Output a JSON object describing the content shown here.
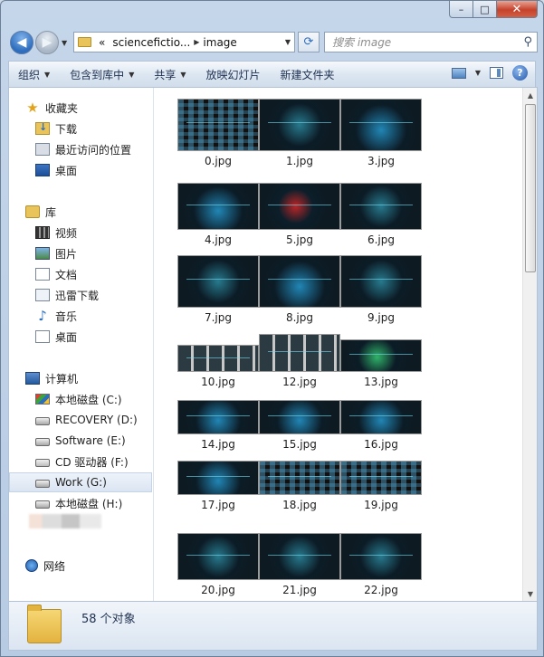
{
  "window": {
    "caption_buttons": {
      "minimize": "–",
      "maximize": "□",
      "close": "✕"
    }
  },
  "address": {
    "overflow": "«",
    "crumbs": [
      "sciencefictio...",
      "image"
    ],
    "search_placeholder": "搜索 image"
  },
  "toolbar": {
    "organize": "组织",
    "include_in_library": "包含到库中",
    "share": "共享",
    "slideshow": "放映幻灯片",
    "new_folder": "新建文件夹",
    "help": "?"
  },
  "nav": {
    "favorites": "收藏夹",
    "downloads": "下载",
    "recent": "最近访问的位置",
    "desktop": "桌面",
    "libraries": "库",
    "videos": "视频",
    "pictures": "图片",
    "documents": "文档",
    "thunder": "迅雷下载",
    "music": "音乐",
    "desktop2": "桌面",
    "computer": "计算机",
    "drive_c": "本地磁盘 (C:)",
    "drive_d": "RECOVERY (D:)",
    "drive_e": "Software (E:)",
    "drive_f": "CD 驱动器 (F:)",
    "drive_g": "Work (G:)",
    "drive_h": "本地磁盘 (H:)",
    "network": "网络"
  },
  "files": [
    {
      "name": "0.jpg",
      "style": "grid-ui"
    },
    {
      "name": "1.jpg",
      "style": ""
    },
    {
      "name": "3.jpg",
      "style": "blue"
    },
    {
      "name": "4.jpg",
      "style": "blue"
    },
    {
      "name": "5.jpg",
      "style": "red"
    },
    {
      "name": "6.jpg",
      "style": ""
    },
    {
      "name": "7.jpg",
      "style": ""
    },
    {
      "name": "8.jpg",
      "style": "blue"
    },
    {
      "name": "9.jpg",
      "style": ""
    },
    {
      "name": "10.jpg",
      "style": "grey"
    },
    {
      "name": "12.jpg",
      "style": "grey"
    },
    {
      "name": "13.jpg",
      "style": "green"
    },
    {
      "name": "14.jpg",
      "style": "blue"
    },
    {
      "name": "15.jpg",
      "style": "blue"
    },
    {
      "name": "16.jpg",
      "style": "blue"
    },
    {
      "name": "17.jpg",
      "style": "blue"
    },
    {
      "name": "18.jpg",
      "style": "grid-ui"
    },
    {
      "name": "19.jpg",
      "style": "grid-ui"
    },
    {
      "name": "20.jpg",
      "style": ""
    },
    {
      "name": "21.jpg",
      "style": ""
    },
    {
      "name": "22.jpg",
      "style": ""
    }
  ],
  "status": {
    "count": "58 个对象"
  }
}
